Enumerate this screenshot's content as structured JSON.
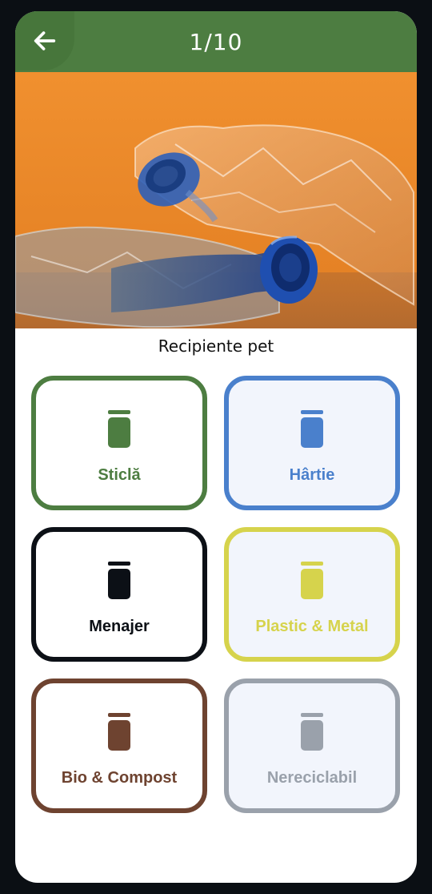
{
  "header": {
    "counter": "1/10"
  },
  "item": {
    "caption": "Recipiente pet",
    "image_icon": "plastic-bottles-photo"
  },
  "bins": [
    {
      "label": "Sticlă",
      "color": "#4d7d41",
      "background": "#ffffff",
      "icon": "trash-icon"
    },
    {
      "label": "Hârtie",
      "color": "#4a80cc",
      "background": "#f2f5fc",
      "icon": "trash-icon"
    },
    {
      "label": "Menajer",
      "color": "#0c1016",
      "background": "#ffffff",
      "icon": "trash-icon"
    },
    {
      "label": "Plastic & Metal",
      "color": "#d6d34c",
      "background": "#f2f5fc",
      "icon": "trash-icon"
    },
    {
      "label": "Bio & Compost",
      "color": "#6e4330",
      "background": "#ffffff",
      "icon": "trash-icon"
    },
    {
      "label": "Nereciclabil",
      "color": "#9aa1ab",
      "background": "#f2f5fc",
      "icon": "trash-icon"
    }
  ]
}
